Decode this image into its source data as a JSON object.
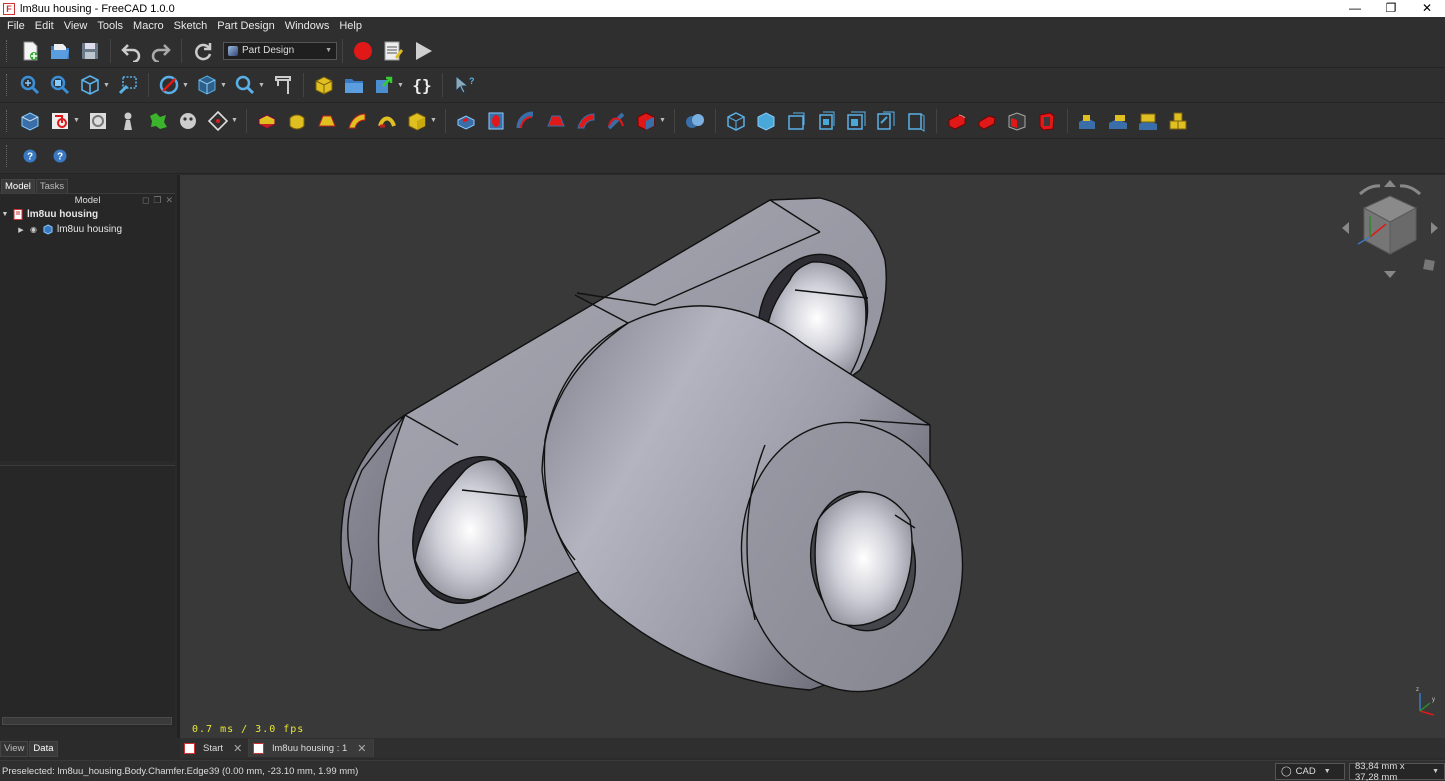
{
  "window": {
    "title": "lm8uu housing - FreeCAD 1.0.0"
  },
  "menu": [
    "File",
    "Edit",
    "View",
    "Tools",
    "Macro",
    "Sketch",
    "Part Design",
    "Windows",
    "Help"
  ],
  "workbench": {
    "selected": "Part Design"
  },
  "panel": {
    "tabs": [
      "Model",
      "Tasks"
    ],
    "header": "Model",
    "tree": {
      "root": "lm8uu housing",
      "child": "lm8uu housing"
    },
    "bottom_tabs": [
      "View",
      "Data"
    ]
  },
  "view": {
    "fps": "0.7 ms / 3.0 fps"
  },
  "document_tabs": [
    "Start",
    "lm8uu housing : 1"
  ],
  "status": {
    "message": "Preselected: lm8uu_housing.Body.Chamfer.Edge39 (0.00 mm, -23.10 mm, 1.99 mm)",
    "nav_style": "CAD",
    "dimensions": "83,84 mm x 37,28 mm"
  },
  "colors": {
    "background": "#393939",
    "accent_red": "#cc2222",
    "accent_blue": "#3a8fd8",
    "accent_yellow": "#e0c020"
  }
}
